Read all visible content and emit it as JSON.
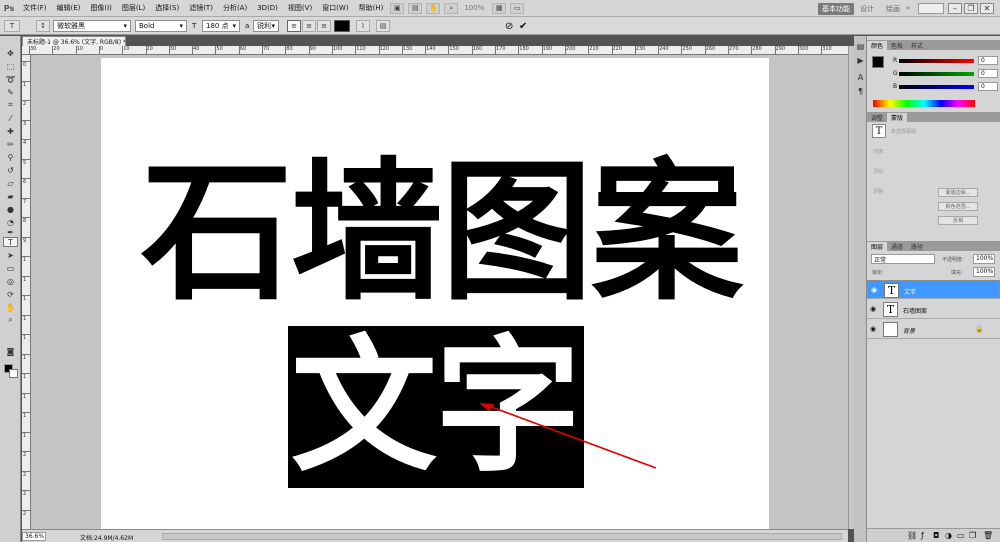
{
  "app": {
    "logo": "Ps"
  },
  "menu": [
    "文件(F)",
    "编辑(E)",
    "图像(I)",
    "图层(L)",
    "选择(S)",
    "滤镜(T)",
    "分析(A)",
    "3D(D)",
    "视图(V)",
    "窗口(W)",
    "帮助(H)"
  ],
  "menubar": {
    "zoom": "100%",
    "workspace": "基本功能",
    "links": [
      "设计",
      "绘画"
    ]
  },
  "options": {
    "font_family": "微软雅黑",
    "font_style": "Bold",
    "font_size": "180 点",
    "antialias": "锐利"
  },
  "document": {
    "tab_title": "未标题-1 @ 36.6% (文字, RGB/8) *",
    "close": "×",
    "line1": "石墙图案",
    "line2": "文字",
    "status_zoom": "36.6%",
    "status_doc": "文档:24.9M/4.62M",
    "ruler_top_labels": [
      "30",
      "20",
      "10",
      "0",
      "10",
      "20",
      "30",
      "40",
      "50",
      "60",
      "70",
      "80",
      "90",
      "100",
      "110",
      "120",
      "130",
      "140",
      "150",
      "160",
      "170",
      "180",
      "190",
      "200",
      "210",
      "220",
      "230",
      "240",
      "250",
      "260",
      "270",
      "280",
      "290",
      "300",
      "310"
    ],
    "ruler_left_labels": [
      "0",
      "1",
      "2",
      "3",
      "4",
      "5",
      "6",
      "7",
      "8",
      "9",
      "1",
      "1",
      "1",
      "1",
      "1",
      "1",
      "1",
      "1",
      "1",
      "1",
      "2",
      "2",
      "2",
      "2"
    ]
  },
  "color_panel": {
    "tabs": [
      "颜色",
      "色板",
      "样式"
    ],
    "channels": [
      {
        "label": "R",
        "value": "0",
        "color": "#ff0000"
      },
      {
        "label": "G",
        "value": "0",
        "color": "#00aa00"
      },
      {
        "label": "B",
        "value": "0",
        "color": "#0000ff"
      }
    ]
  },
  "adjust_panel": {
    "tabs": [
      "调整",
      "蒙版"
    ],
    "hint": "未选择蒙版",
    "labels": [
      "浓度:",
      "羽化:",
      "调整:"
    ],
    "buttons": [
      "蒙版边缘...",
      "颜色范围...",
      "反相"
    ]
  },
  "layers_panel": {
    "tabs": [
      "图层",
      "通道",
      "路径"
    ],
    "blend_mode": "正常",
    "opacity_label": "不透明度:",
    "opacity": "100%",
    "lock_label": "锁定:",
    "fill_label": "填充:",
    "fill": "100%",
    "layers": [
      {
        "name": "文字",
        "thumb": "T",
        "selected": true
      },
      {
        "name": "石墙图案",
        "thumb": "T",
        "selected": false
      },
      {
        "name": "背景",
        "thumb": "",
        "selected": false
      }
    ]
  }
}
